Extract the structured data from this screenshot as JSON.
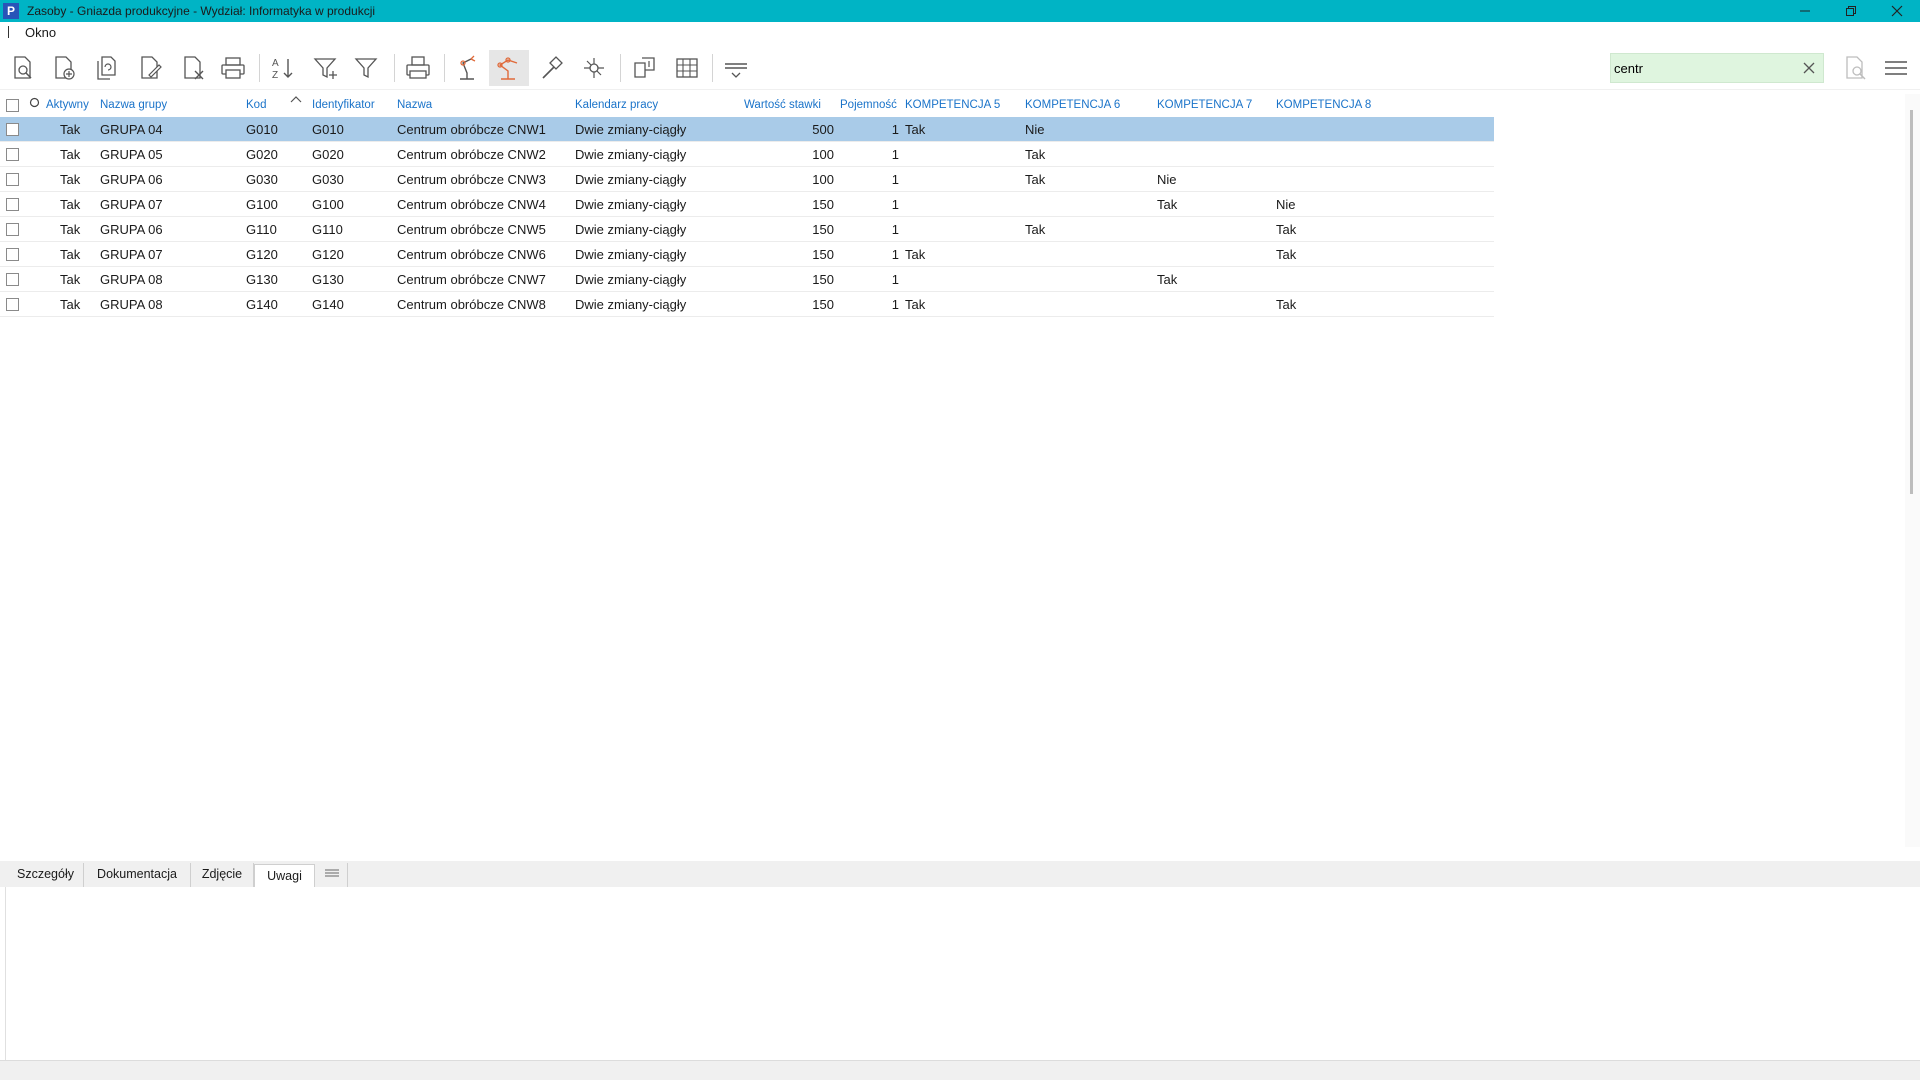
{
  "window": {
    "title": "Zasoby - Gniazda produkcyjne - Wydział: Informatyka w produkcji",
    "logo": "P",
    "controls": [
      "minimize-icon",
      "restore-icon",
      "close-icon"
    ]
  },
  "menu": {
    "items": [
      "Okno"
    ]
  },
  "toolbar": {
    "buttons": [
      "view-icon",
      "new-document-icon",
      "copy-document-icon",
      "edit-document-icon",
      "delete-document-icon",
      "print-icon",
      "sort-az-icon",
      "filter-plus-icon",
      "filter-icon",
      "print-preview-icon",
      "robot-arm-icon",
      "robot-arm-active-icon",
      "hammer-icon",
      "network-icon",
      "columns-layout-icon",
      "grid-icon",
      "menu-filter-icon"
    ],
    "search_value": "centr"
  },
  "grid": {
    "columns": [
      "Aktywny",
      "Nazwa grupy",
      "Kod",
      "Identyfikator",
      "Nazwa",
      "Kalendarz pracy",
      "Wartość stawki",
      "Pojemność",
      "KOMPETENCJA 5",
      "KOMPETENCJA 6",
      "KOMPETENCJA 7",
      "KOMPETENCJA 8"
    ],
    "rows": [
      {
        "aktywny": "Tak",
        "grupa": "GRUPA 04",
        "kod": "G010",
        "id": "G010",
        "nazwa": "Centrum obróbcze CNW1",
        "kalendarz": "Dwie zmiany-ciągły",
        "stawka": "500",
        "pojemnosc": "1",
        "k5": "Tak",
        "k6": "Nie",
        "k7": "",
        "k8": ""
      },
      {
        "aktywny": "Tak",
        "grupa": "GRUPA 05",
        "kod": "G020",
        "id": "G020",
        "nazwa": "Centrum obróbcze CNW2",
        "kalendarz": "Dwie zmiany-ciągły",
        "stawka": "100",
        "pojemnosc": "1",
        "k5": "",
        "k6": "Tak",
        "k7": "",
        "k8": ""
      },
      {
        "aktywny": "Tak",
        "grupa": "GRUPA 06",
        "kod": "G030",
        "id": "G030",
        "nazwa": "Centrum obróbcze CNW3",
        "kalendarz": "Dwie zmiany-ciągły",
        "stawka": "100",
        "pojemnosc": "1",
        "k5": "",
        "k6": "Tak",
        "k7": "Nie",
        "k8": ""
      },
      {
        "aktywny": "Tak",
        "grupa": "GRUPA 07",
        "kod": "G100",
        "id": "G100",
        "nazwa": "Centrum obróbcze CNW4",
        "kalendarz": "Dwie zmiany-ciągły",
        "stawka": "150",
        "pojemnosc": "1",
        "k5": "",
        "k6": "",
        "k7": "Tak",
        "k8": "Nie"
      },
      {
        "aktywny": "Tak",
        "grupa": "GRUPA 06",
        "kod": "G110",
        "id": "G110",
        "nazwa": "Centrum obróbcze CNW5",
        "kalendarz": "Dwie zmiany-ciągły",
        "stawka": "150",
        "pojemnosc": "1",
        "k5": "",
        "k6": "Tak",
        "k7": "",
        "k8": "Tak"
      },
      {
        "aktywny": "Tak",
        "grupa": "GRUPA 07",
        "kod": "G120",
        "id": "G120",
        "nazwa": "Centrum obróbcze CNW6",
        "kalendarz": "Dwie zmiany-ciągły",
        "stawka": "150",
        "pojemnosc": "1",
        "k5": "Tak",
        "k6": "",
        "k7": "",
        "k8": "Tak"
      },
      {
        "aktywny": "Tak",
        "grupa": "GRUPA 08",
        "kod": "G130",
        "id": "G130",
        "nazwa": "Centrum obróbcze CNW7",
        "kalendarz": "Dwie zmiany-ciągły",
        "stawka": "150",
        "pojemnosc": "1",
        "k5": "",
        "k6": "",
        "k7": "Tak",
        "k8": ""
      },
      {
        "aktywny": "Tak",
        "grupa": "GRUPA 08",
        "kod": "G140",
        "id": "G140",
        "nazwa": "Centrum obróbcze CNW8",
        "kalendarz": "Dwie zmiany-ciągły",
        "stawka": "150",
        "pojemnosc": "1",
        "k5": "Tak",
        "k6": "",
        "k7": "",
        "k8": "Tak"
      }
    ]
  },
  "tabs": [
    "Szczegóły",
    "Dokumentacja",
    "Zdjęcie",
    "Uwagi"
  ],
  "active_tab": "Uwagi",
  "colors": {
    "titlebar": "#00b4c5",
    "header_text": "#1a73c9",
    "selected_row": "#a9cbe8",
    "search_bg": "#dff5df",
    "accent_icon": "#e06a3a"
  }
}
